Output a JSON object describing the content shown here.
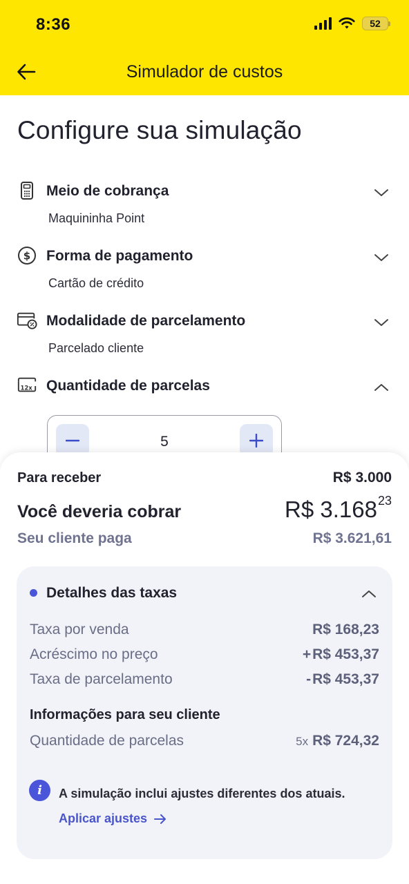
{
  "status_bar": {
    "time": "8:36",
    "battery": "52"
  },
  "header": {
    "title": "Simulador de custos"
  },
  "page_title": "Configure sua simulação",
  "config_rows": [
    {
      "label": "Meio de cobrança",
      "value": "Maquininha Point",
      "icon": "card-machine-icon",
      "expanded": false
    },
    {
      "label": "Forma de pagamento",
      "value": "Cartão de crédito",
      "icon": "dollar-circle-icon",
      "expanded": false
    },
    {
      "label": "Modalidade de parcelamento",
      "value": "Parcelado cliente",
      "icon": "card-percent-icon",
      "expanded": false
    },
    {
      "label": "Quantidade de parcelas",
      "value": "",
      "icon": "installments-12x-icon",
      "expanded": true
    }
  ],
  "stepper": {
    "value": "5"
  },
  "summary": {
    "receive_label": "Para receber",
    "receive_value": "R$ 3.000",
    "charge_label": "Você deveria cobrar",
    "charge_value_main": "R$ 3.168",
    "charge_value_cents": "23",
    "client_pays_label": "Seu cliente paga",
    "client_pays_value": "R$ 3.621,61"
  },
  "details": {
    "title": "Detalhes das taxas",
    "fees": [
      {
        "label": "Taxa por venda",
        "sign": "",
        "value": "R$ 168,23"
      },
      {
        "label": "Acréscimo no preço",
        "sign": "+",
        "value": "R$ 453,37"
      },
      {
        "label": "Taxa de parcelamento",
        "sign": "-",
        "value": "R$ 453,37"
      }
    ],
    "client_info_title": "Informações para seu cliente",
    "installments_label": "Quantidade de parcelas",
    "installments_count": "5x",
    "installments_value": "R$ 724,32",
    "notice_text": "A simulação inclui ajustes diferentes dos atuais.",
    "apply_link": "Aplicar ajustes"
  },
  "colors": {
    "header_bg": "#ffe600",
    "accent": "#4a55d9",
    "card_bg": "#f1f3f8",
    "muted_text": "#6f7390"
  }
}
